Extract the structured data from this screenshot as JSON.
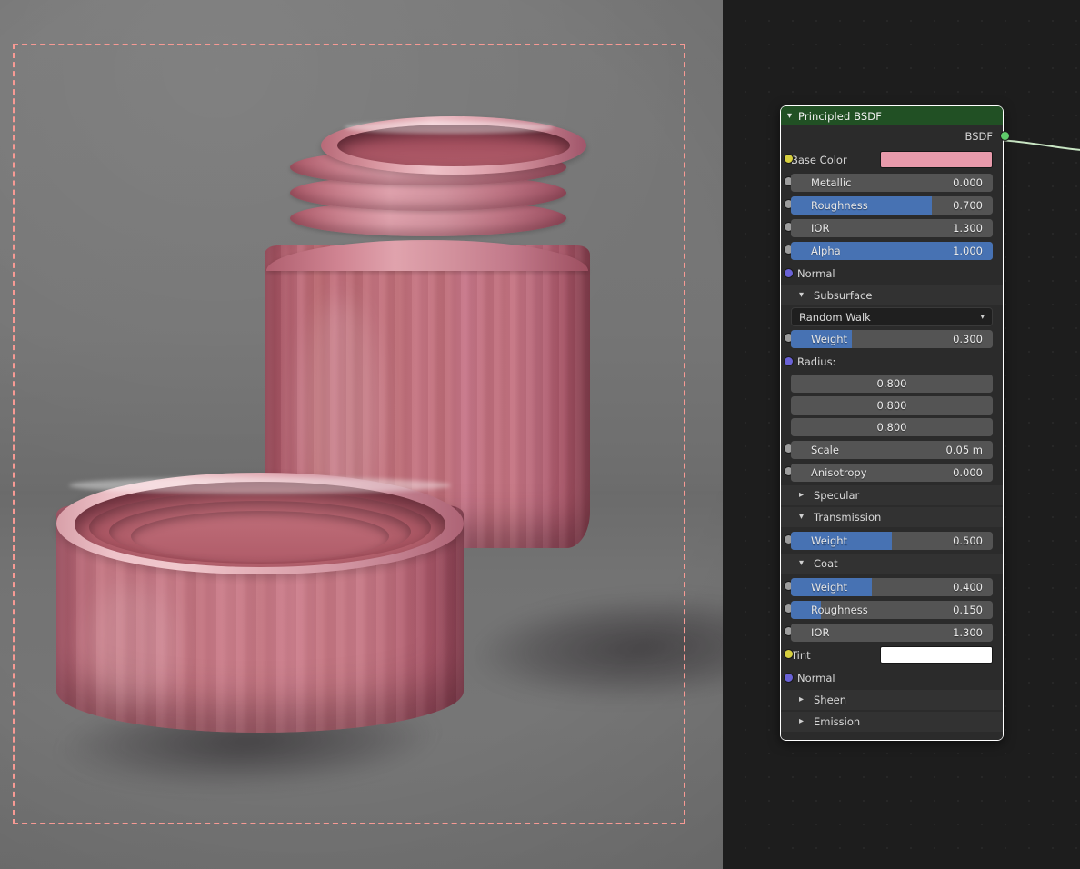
{
  "viewport": {
    "name": "3d-viewport",
    "camera_frame": "camera-passepartout",
    "frame_color": "#f79a94",
    "background_color": "#6e6e6e",
    "objects": [
      {
        "name": "jar-body",
        "description": "Fluted pink cosmetic jar with threaded neck"
      },
      {
        "name": "jar-cap",
        "description": "Matching fluted pink cap resting upside down"
      }
    ]
  },
  "node_editor": {
    "name": "shader-node-editor",
    "background_color": "#1d1d1d",
    "node": {
      "title": "Principled BSDF",
      "header_color": "#215024",
      "collapse_icon": "chevron-down-icon",
      "output": {
        "label": "BSDF",
        "socket_color": "#5fca6a"
      },
      "base_color": {
        "label": "Base Color",
        "socket_color": "#d6cf3f",
        "value": "#e89aab"
      },
      "sliders": [
        {
          "label": "Metallic",
          "value": "0.000",
          "fill": 0.0
        },
        {
          "label": "Roughness",
          "value": "0.700",
          "fill": 0.7
        },
        {
          "label": "IOR",
          "value": "1.300",
          "fill": 0.0
        },
        {
          "label": "Alpha",
          "value": "1.000",
          "fill": 1.0
        }
      ],
      "normal_top": {
        "label": "Normal",
        "socket_color": "#6a62d6"
      },
      "subsurface": {
        "label": "Subsurface",
        "expanded": true,
        "method": "Random Walk",
        "weight": {
          "label": "Weight",
          "value": "0.300",
          "fill": 0.3
        },
        "radius_label": "Radius:",
        "radius": [
          "0.800",
          "0.800",
          "0.800"
        ],
        "scale": {
          "label": "Scale",
          "value": "0.05 m"
        },
        "anisotropy": {
          "label": "Anisotropy",
          "value": "0.000"
        }
      },
      "specular": {
        "label": "Specular",
        "expanded": false
      },
      "transmission": {
        "label": "Transmission",
        "expanded": true,
        "weight": {
          "label": "Weight",
          "value": "0.500",
          "fill": 0.5
        }
      },
      "coat": {
        "label": "Coat",
        "expanded": true,
        "weight": {
          "label": "Weight",
          "value": "0.400",
          "fill": 0.4
        },
        "roughness": {
          "label": "Roughness",
          "value": "0.150",
          "fill": 0.15
        },
        "ior": {
          "label": "IOR",
          "value": "1.300",
          "fill": 0.0
        },
        "tint": {
          "label": "Tint",
          "value": "#ffffff",
          "socket_color": "#d6cf3f"
        },
        "normal": {
          "label": "Normal",
          "socket_color": "#6a62d6"
        }
      },
      "sheen": {
        "label": "Sheen",
        "expanded": false
      },
      "emission": {
        "label": "Emission",
        "expanded": false
      }
    }
  }
}
